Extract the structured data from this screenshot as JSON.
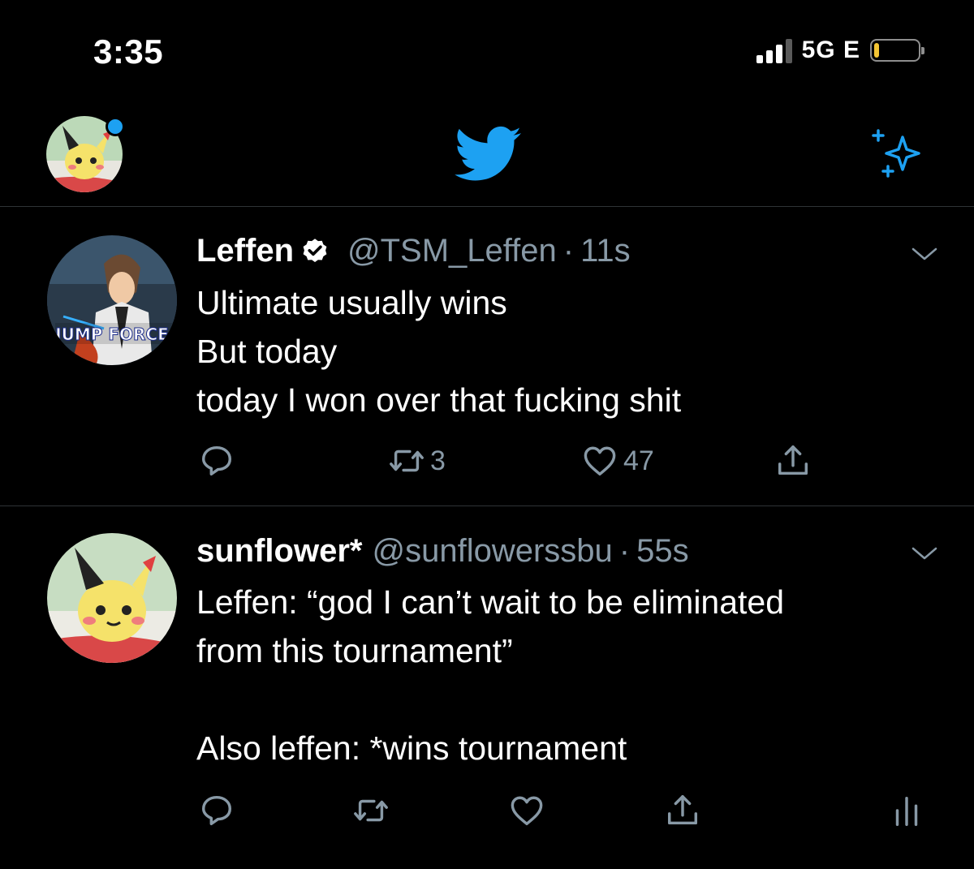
{
  "status_bar": {
    "time": "3:35",
    "network": "5G E",
    "signal_bars_filled": 3,
    "battery_level": 0.1
  },
  "header": {
    "logo": "twitter-bird-icon",
    "left": "profile-avatar",
    "right": "sparkle-icon"
  },
  "tweets": [
    {
      "display_name": "Leffen",
      "verified": true,
      "handle": "@TSM_Leffen",
      "separator": "·",
      "time": "11s",
      "text": "Ultimate usually wins\nBut today\ntoday I won over that fucking shit",
      "avatar_label": "JUMP FORCE",
      "reply_count": "",
      "retweet_count": "3",
      "like_count": "47"
    },
    {
      "display_name": "sunflower*",
      "verified": false,
      "handle": "@sunflowerssbu",
      "separator": "·",
      "time": "55s",
      "text": "Leffen: “god I can’t wait to be eliminated\nfrom this tournament”\n\nAlso leffen: *wins tournament",
      "reply_count": "",
      "retweet_count": "",
      "like_count": ""
    }
  ],
  "colors": {
    "background": "#000000",
    "accent": "#1da1f2",
    "secondary_text": "#8899a6",
    "divider": "#2f3336"
  }
}
